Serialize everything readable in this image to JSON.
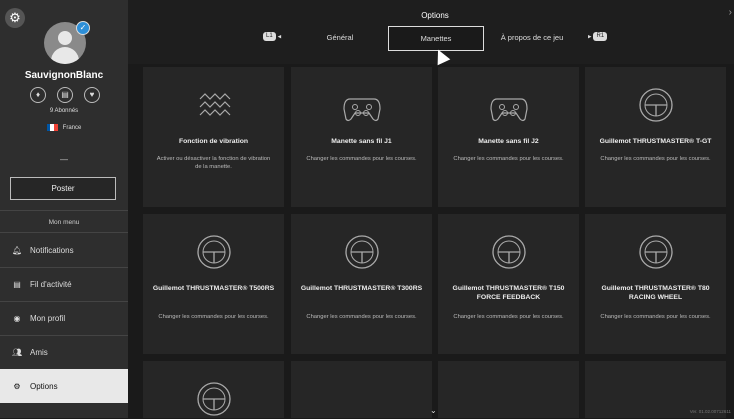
{
  "sidebar": {
    "username": "SauvignonBlanc",
    "followers": "9 Abonnés",
    "country": "France",
    "status": "—",
    "post_label": "Poster",
    "menu_label": "Mon menu",
    "items": [
      {
        "label": "Notifications",
        "icon": "bell-icon"
      },
      {
        "label": "Fil d'activité",
        "icon": "feed-icon"
      },
      {
        "label": "Mon profil",
        "icon": "profile-icon"
      },
      {
        "label": "Amis",
        "icon": "friends-icon"
      },
      {
        "label": "Options",
        "icon": "gear-icon",
        "active": true
      }
    ],
    "flag_colors": [
      "#0055a4",
      "#ffffff",
      "#ef4135"
    ]
  },
  "header": {
    "title": "Options",
    "left_hint": "L1",
    "right_hint": "R1",
    "tabs": [
      {
        "label": "Général"
      },
      {
        "label": "Manettes",
        "active": true
      },
      {
        "label": "À propos de ce jeu"
      }
    ]
  },
  "cards": [
    {
      "title": "Fonction de vibration",
      "desc": "Activer ou désactiver la fonction de vibration de la manette.",
      "icon": "vibration-icon"
    },
    {
      "title": "Manette sans fil J1",
      "desc": "Changer les commandes pour les courses.",
      "icon": "gamepad-icon"
    },
    {
      "title": "Manette sans fil J2",
      "desc": "Changer les commandes pour les courses.",
      "icon": "gamepad-icon"
    },
    {
      "title": "Guillemot THRUSTMASTER® T-GT",
      "desc": "Changer les commandes pour les courses.",
      "icon": "steering-wheel-icon"
    },
    {
      "title": "Guillemot THRUSTMASTER® T500RS",
      "desc": "Changer les commandes pour les courses.",
      "icon": "steering-wheel-icon"
    },
    {
      "title": "Guillemot THRUSTMASTER® T300RS",
      "desc": "Changer les commandes pour les courses.",
      "icon": "steering-wheel-icon"
    },
    {
      "title": "Guillemot THRUSTMASTER® T150 FORCE FEEDBACK",
      "desc": "Changer les commandes pour les courses.",
      "icon": "steering-wheel-icon"
    },
    {
      "title": "Guillemot THRUSTMASTER® T80 RACING WHEEL",
      "desc": "Changer les commandes pour les courses.",
      "icon": "steering-wheel-icon"
    },
    {
      "title": "",
      "desc": "",
      "icon": "steering-wheel-icon"
    },
    {
      "title": "",
      "desc": "",
      "icon": ""
    },
    {
      "title": "",
      "desc": "",
      "icon": ""
    },
    {
      "title": "",
      "desc": "",
      "icon": ""
    }
  ],
  "version": "Ver. 01.02.00712611"
}
